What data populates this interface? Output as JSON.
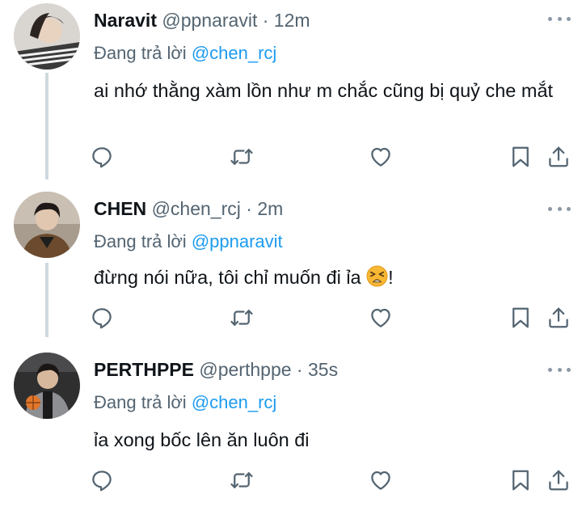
{
  "tweets": [
    {
      "name": "Naravit",
      "handle": "@ppnaravit",
      "dot": "·",
      "time": "12m",
      "reply_prefix": "Đang trả lời ",
      "reply_to": "@chen_rcj",
      "text": "ai nhớ thằng xàm lồn như m chắc cũng bị quỷ che mắt"
    },
    {
      "name": "CHEN",
      "handle": "@chen_rcj",
      "dot": "·",
      "time": "2m",
      "reply_prefix": "Đang trả lời ",
      "reply_to": "@ppnaravit",
      "text_before_emoji": "đừng nói nữa, tôi chỉ muốn đi ỉa ",
      "emoji": "tired-face-emoji",
      "text_after_emoji": "!"
    },
    {
      "name": "PERTHPPE",
      "handle": "@perthppe",
      "dot": "·",
      "time": "35s",
      "reply_prefix": "Đang trả lời ",
      "reply_to": "@chen_rcj",
      "text": "ỉa xong bốc lên ăn luôn đi"
    }
  ],
  "icons": {
    "reply": "reply-icon",
    "retweet": "retweet-icon",
    "like": "like-icon",
    "bookmark": "bookmark-icon",
    "share": "share-icon",
    "more": "more-icon"
  },
  "colors": {
    "text": "#0f1419",
    "secondary": "#536471",
    "mention": "#1d9bf0",
    "thread_line": "#cfd9de"
  }
}
